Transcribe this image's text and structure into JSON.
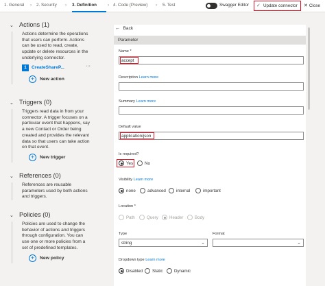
{
  "tabs": [
    {
      "label": "1. General"
    },
    {
      "label": "2. Security"
    },
    {
      "label": "3. Definition"
    },
    {
      "label": "4. Code (Preview)"
    },
    {
      "label": "5. Test"
    }
  ],
  "tab_separator": "›",
  "toolbar": {
    "swagger_label": "Swagger Editor",
    "update_label": "Update connector",
    "close_label": "Close"
  },
  "left": {
    "actions": {
      "title": "Actions (1)",
      "desc": "Actions determine the operations that users can perform. Actions can be used to read, create, update or delete resources in the underlying connector.",
      "item_num": "1",
      "item_name": "CreateShareP...",
      "item_more": "···",
      "add_label": "New action"
    },
    "triggers": {
      "title": "Triggers (0)",
      "desc": "Triggers read data in from your connector. A trigger focuses on a particular event that happens, say a new Contact or Order being created and provides the relevant data so that users can take action on that event.",
      "add_label": "New trigger"
    },
    "references": {
      "title": "References (0)",
      "desc": "References are reusable parameters used by both actions and triggers."
    },
    "policies": {
      "title": "Policies (0)",
      "desc": "Policies are used to change the behavior of actions and triggers through configuration. You can use one or more policies from a set of predefined templates.",
      "add_label": "New policy"
    }
  },
  "right": {
    "back_label": "Back",
    "panel_title": "Parameter",
    "name_label": "Name *",
    "name_value": "accept",
    "description_label": "Description",
    "description_link": "Learn more",
    "summary_label": "Summary",
    "summary_link": "Learn more",
    "default_label": "Default value",
    "default_value": "application/json",
    "required_label": "Is required?",
    "required_yes": "Yes",
    "required_no": "No",
    "visibility_label": "Visibility",
    "visibility_link": "Learn more",
    "visibility_options": [
      "none",
      "advanced",
      "internal",
      "important"
    ],
    "location_label": "Location *",
    "location_options": [
      "Path",
      "Query",
      "Header",
      "Body"
    ],
    "type_label": "Type",
    "type_value": "string",
    "format_label": "Format",
    "format_value": "",
    "dropdown_label": "Dropdown type",
    "dropdown_link": "Learn more",
    "dropdown_options": [
      "Disabled",
      "Static",
      "Dynamic"
    ]
  },
  "colors": {
    "accent": "#0078d4",
    "highlight": "#e81123"
  }
}
